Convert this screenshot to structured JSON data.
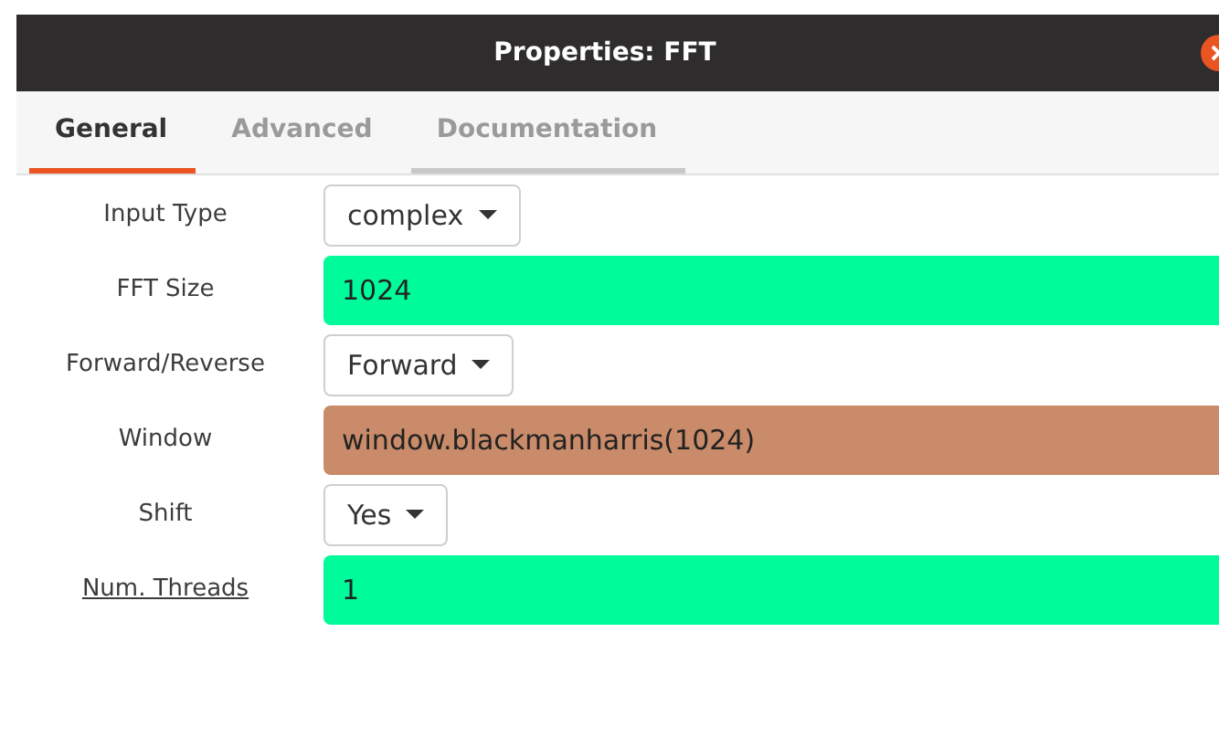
{
  "window": {
    "title": "Properties: FFT"
  },
  "tabs": [
    {
      "label": "General",
      "selected": true,
      "hovered": false
    },
    {
      "label": "Advanced",
      "selected": false,
      "hovered": false
    },
    {
      "label": "Documentation",
      "selected": false,
      "hovered": true
    }
  ],
  "params": [
    {
      "label": "Input Type",
      "kind": "combo",
      "value": "complex",
      "underlined": false
    },
    {
      "label": "FFT Size",
      "kind": "entry",
      "value": "1024",
      "color": "#00fc9a",
      "underlined": false
    },
    {
      "label": "Forward/Reverse",
      "kind": "combo",
      "value": "Forward",
      "underlined": false
    },
    {
      "label": "Window",
      "kind": "entry",
      "value": "window.blackmanharris(1024)",
      "color": "#c98b69",
      "underlined": false
    },
    {
      "label": "Shift",
      "kind": "combo",
      "value": "Yes",
      "underlined": false
    },
    {
      "label": "Num. Threads",
      "kind": "entry",
      "value": "1",
      "color": "#00fc9a",
      "underlined": true
    }
  ]
}
